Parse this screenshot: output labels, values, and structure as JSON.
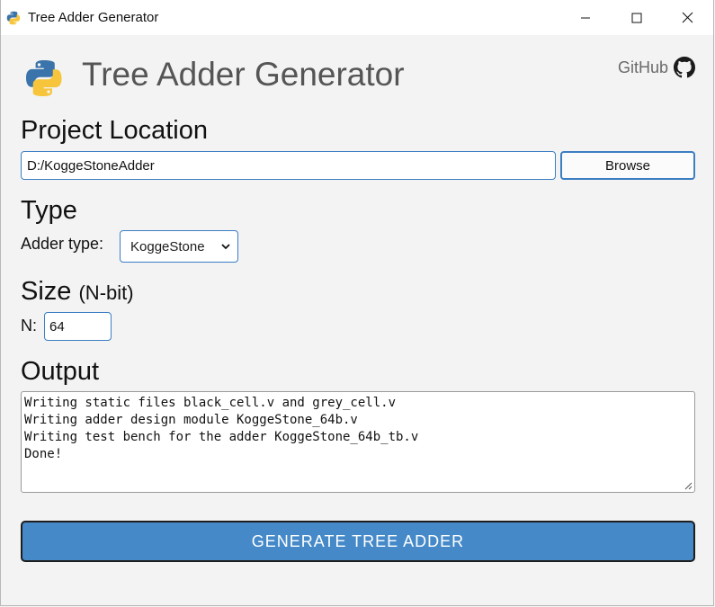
{
  "window": {
    "title": "Tree Adder Generator",
    "controls": [
      "minimize",
      "maximize",
      "close"
    ]
  },
  "header": {
    "title": "Tree Adder Generator",
    "github_label": "GitHub"
  },
  "project": {
    "heading": "Project Location",
    "path_value": "D:/KoggeStoneAdder",
    "browse_label": "Browse"
  },
  "type": {
    "heading": "Type",
    "adder_label": "Adder type:",
    "adder_selected": "KoggeStone"
  },
  "size": {
    "heading": "Size",
    "subheading": "(N-bit)",
    "n_label": "N:",
    "n_value": "64"
  },
  "output": {
    "heading": "Output",
    "lines": [
      "Writing static files black_cell.v and grey_cell.v",
      "Writing adder design module KoggeStone_64b.v",
      "Writing test bench for the adder KoggeStone_64b_tb.v",
      "Done!"
    ]
  },
  "actions": {
    "generate_label": "GENERATE TREE ADDER"
  },
  "colors": {
    "accent": "#3c7ec2",
    "button_primary": "#4589c8",
    "python_blue": "#3b74aa",
    "python_yellow": "#f6c53b"
  }
}
